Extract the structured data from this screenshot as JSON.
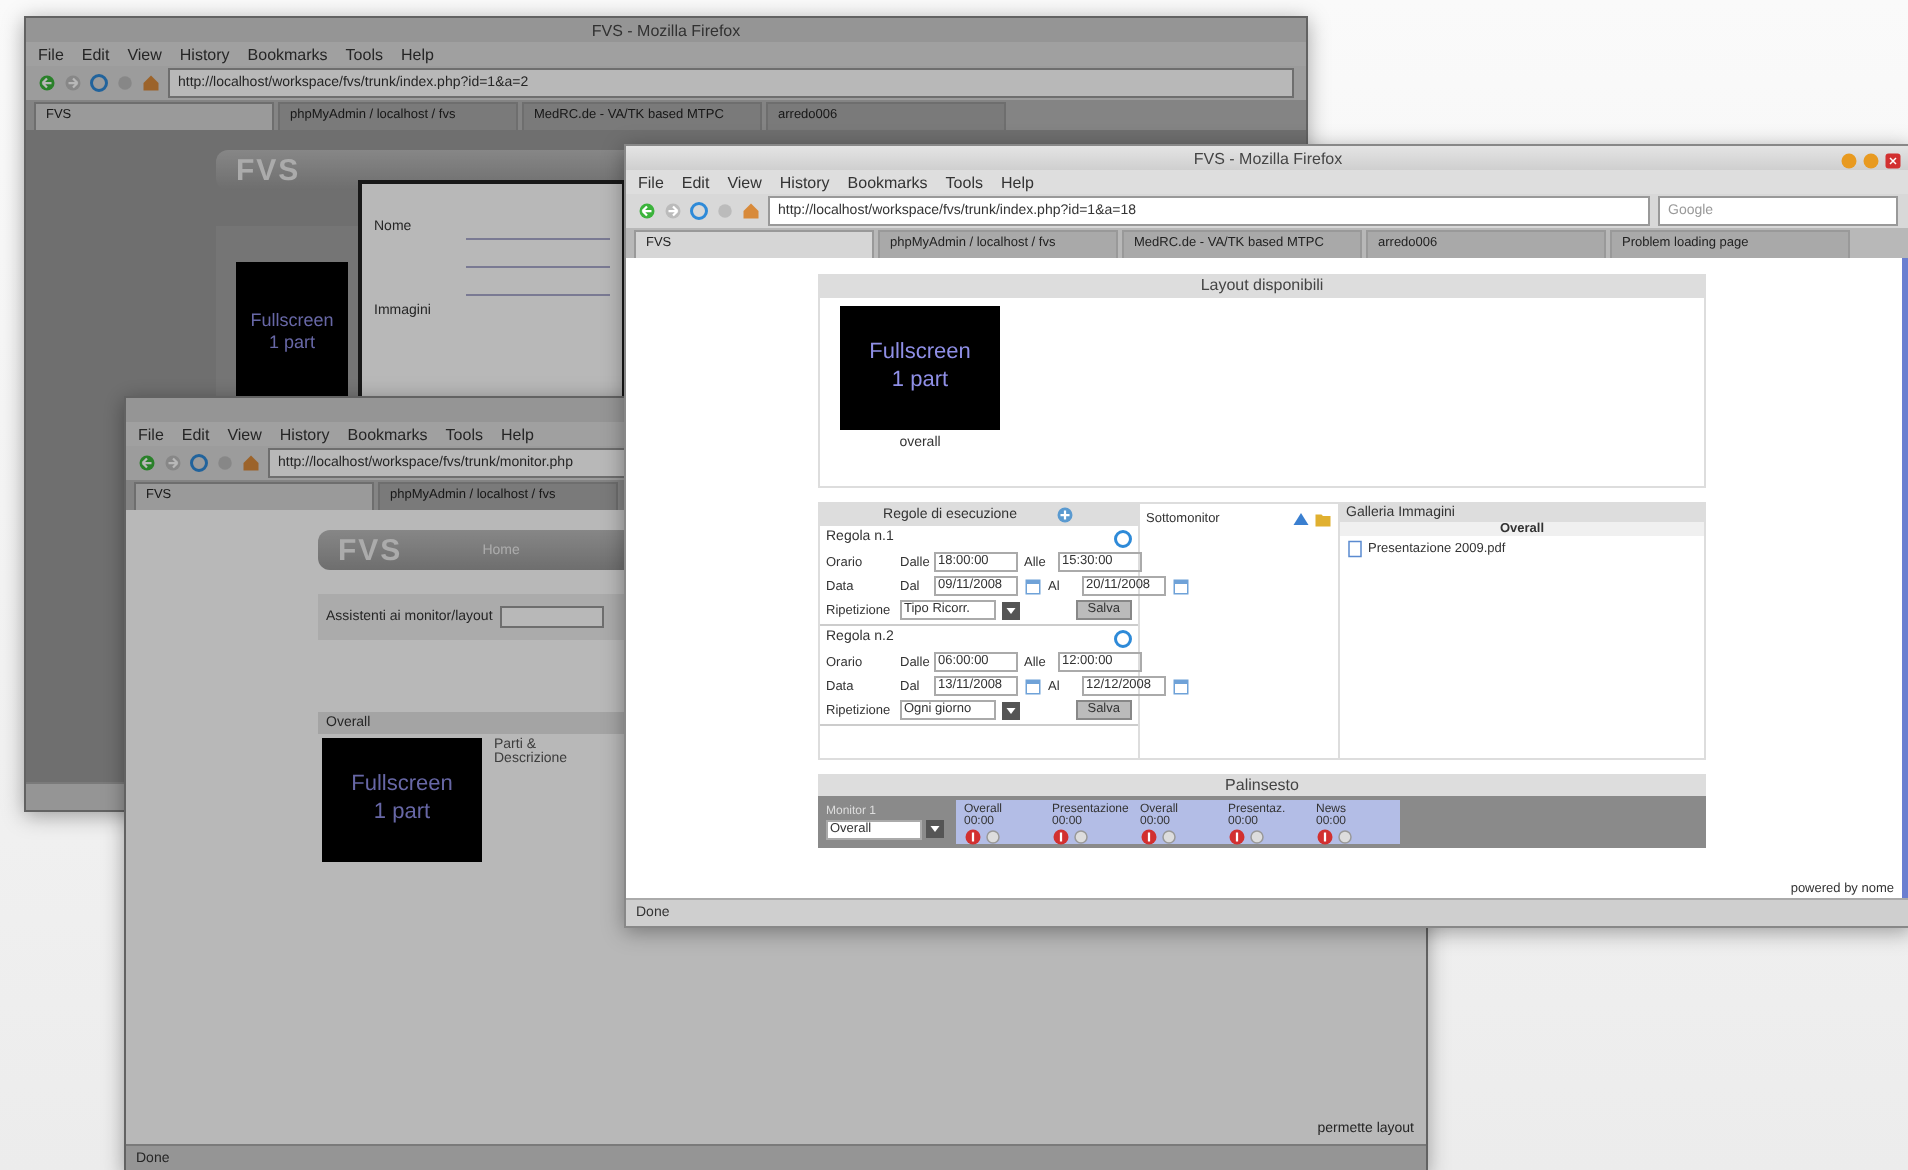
{
  "windows": [
    {
      "active": false,
      "title": "FVS - Mozilla Firefox",
      "menu": [
        "File",
        "Edit",
        "View",
        "History",
        "Bookmarks",
        "Tools",
        "Help"
      ],
      "url": "http://localhost/workspace/fvs/trunk/index.php?id=1&a=2",
      "tabs": [
        {
          "label": "FVS",
          "selected": true
        },
        {
          "label": "phpMyAdmin / localhost / fvs",
          "selected": false
        },
        {
          "label": "MedRC.de - VA/TK based MTPC",
          "selected": false
        },
        {
          "label": "arredo006",
          "selected": false
        }
      ],
      "page": {
        "kind": "home",
        "logo": "FVS",
        "thumb": "Fullscreen\n1 part",
        "dialog": {
          "label": "Nome",
          "label_2": "Immagini"
        }
      }
    },
    {
      "active": false,
      "menu": [
        "File",
        "Edit",
        "View",
        "History",
        "Bookmarks",
        "Tools",
        "Help"
      ],
      "url": "http://localhost/workspace/fvs/trunk/monitor.php",
      "tabs": [
        {
          "label": "FVS",
          "selected": true
        },
        {
          "label": "phpMyAdmin / localhost / fvs",
          "selected": false
        }
      ],
      "status": "Done",
      "page": {
        "kind": "monitor",
        "logo": "FVS",
        "nav": [
          "Home"
        ],
        "field_label": "Assistenti ai monitor/layout",
        "section": "Overall",
        "thumb": "Fullscreen\n1 part",
        "description": "Parti &\nDescrizione",
        "footer": "permette layout"
      }
    },
    {
      "active": true,
      "title": "FVS - Mozilla Firefox",
      "menu": [
        "File",
        "Edit",
        "View",
        "History",
        "Bookmarks",
        "Tools",
        "Help"
      ],
      "url": "http://localhost/workspace/fvs/trunk/index.php?id=1&a=18",
      "search": "Google",
      "tabs": [
        {
          "label": "FVS",
          "selected": true
        },
        {
          "label": "phpMyAdmin / localhost / fvs",
          "selected": false
        },
        {
          "label": "MedRC.de - VA/TK based MTPC",
          "selected": false
        },
        {
          "label": "arredo006",
          "selected": false
        },
        {
          "label": "Problem loading page",
          "selected": false
        }
      ],
      "status": "Done",
      "page": {
        "kind": "layouts",
        "layouts_title": "Layout disponibili",
        "thumb": "Fullscreen\n1 part",
        "thumb_caption": "overall",
        "rules_title": "Regole di esecuzione",
        "rules": [
          {
            "title": "Regola n.1",
            "time_label": "Orario",
            "from_label": "Dalle",
            "start": "18:00:00",
            "to_label": "Alle",
            "end": "15:30:00",
            "date_label": "Data",
            "date_from_label": "Dal",
            "date_from": "09/11/2008",
            "date_to_label": "Al",
            "date_to": "20/11/2008",
            "repeat_label": "Ripetizione",
            "repeat": "Tipo Ricorr.",
            "button": "Salva"
          },
          {
            "title": "Regola n.2",
            "time_label": "Orario",
            "from_label": "Dalle",
            "start": "06:00:00",
            "to_label": "Alle",
            "end": "12:00:00",
            "date_label": "Data",
            "date_from_label": "Dal",
            "date_from": "13/11/2008",
            "date_to_label": "Al",
            "date_to": "12/12/2008",
            "repeat_label": "Ripetizione",
            "repeat": "Ogni giorno",
            "button": "Salva"
          }
        ],
        "sub_title": "Sottomonitor",
        "gallery_title": "Galleria Immagini",
        "gallery_sub": "Overall",
        "gallery_items": [
          "Presentazione 2009.pdf"
        ],
        "schedule_title": "Palinsesto",
        "monitor_label": "Monitor 1",
        "monitor_value": "Overall",
        "slots": [
          {
            "name": "Overall",
            "sub": "00:00"
          },
          {
            "name": "Presentazione",
            "sub": "00:00"
          },
          {
            "name": "Overall",
            "sub": "00:00"
          },
          {
            "name": "Presentaz.",
            "sub": "00:00"
          },
          {
            "name": "News",
            "sub": "00:00"
          }
        ],
        "footer": "powered by nome"
      }
    }
  ]
}
